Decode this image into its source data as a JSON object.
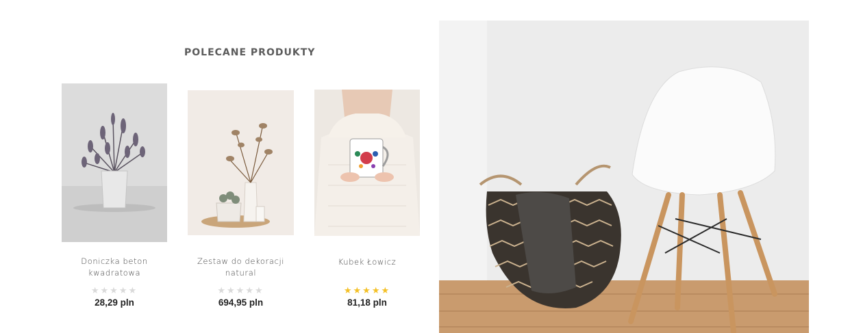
{
  "section": {
    "title": "POLECANE PRODUKTY"
  },
  "products": [
    {
      "name": "Doniczka beton kwadratowa",
      "rating": 0,
      "price": "28,29 pln"
    },
    {
      "name": "Zestaw do dekoracji natural",
      "rating": 0,
      "price": "694,95 pln"
    },
    {
      "name": "Kubek Łowicz",
      "rating": 5,
      "price": "81,18 pln"
    }
  ],
  "colors": {
    "star_active": "#f4c025",
    "star_inactive": "#d9d9d9",
    "title": "#5b5b5b"
  }
}
